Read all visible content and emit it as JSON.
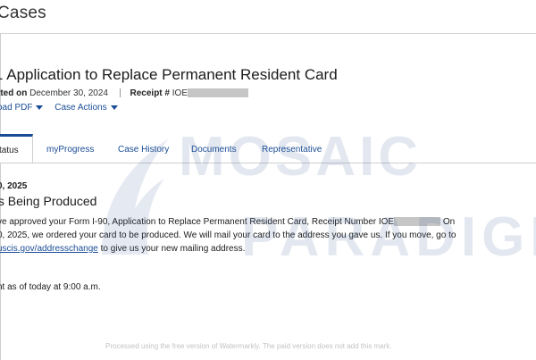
{
  "header": {
    "title": "Cases"
  },
  "case": {
    "title": "1 Application to Replace Permanent Resident Card",
    "submitted_label": "tted on",
    "submitted_date": "December 30, 2024",
    "receipt_label": "Receipt #",
    "receipt_prefix": "IOE"
  },
  "actions": {
    "download_pdf": "oad PDF",
    "case_actions": "Case Actions"
  },
  "tabs": [
    {
      "label": "tatus",
      "active": true
    },
    {
      "label": "myProgress",
      "active": false
    },
    {
      "label": "Case History",
      "active": false
    },
    {
      "label": "Documents",
      "active": false
    },
    {
      "label": "Representative",
      "active": false
    }
  ],
  "status": {
    "date": "0, 2025",
    "title": "Is Being Produced",
    "body_part1": "ve approved your Form I-90, Application to Replace Permanent Resident Card, Receipt Number IOE",
    "body_part2": " On",
    "body_part3": "0, 2025, we ordered your card to be produced. We will mail your card to the address you gave us. If you move, go to",
    "link_text": "uscis.gov/addresschange",
    "body_part4": " to give us your new mailing address.",
    "as_of": "nt as of today at 9:00 a.m."
  },
  "watermark": {
    "line1": "MOSAIC",
    "line2": "PARADIGM",
    "footer": "Processed using the free version of Watermarkly. The paid version does not add this mark."
  },
  "colors": {
    "link": "#1a4c96",
    "mask": "#c6c6c6"
  }
}
